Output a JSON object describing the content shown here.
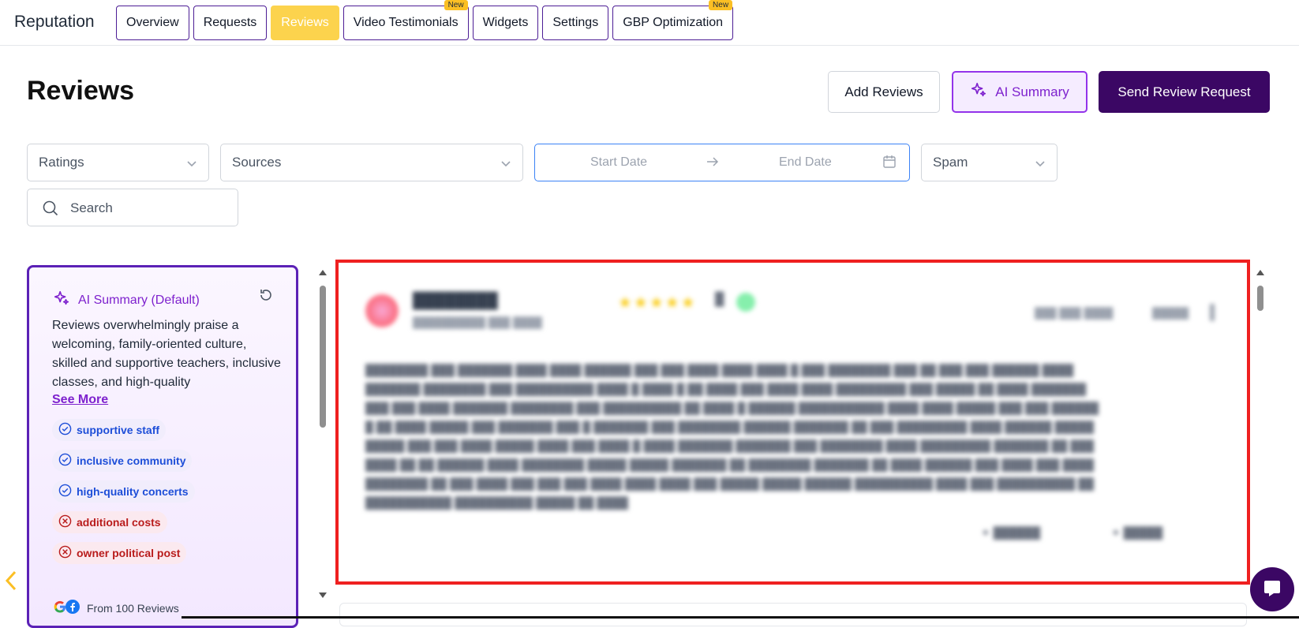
{
  "app": {
    "title": "Reputation"
  },
  "tabs": [
    {
      "label": "Overview",
      "active": false,
      "new": false
    },
    {
      "label": "Requests",
      "active": false,
      "new": false
    },
    {
      "label": "Reviews",
      "active": true,
      "new": false
    },
    {
      "label": "Video Testimonials",
      "active": false,
      "new": true
    },
    {
      "label": "Widgets",
      "active": false,
      "new": false
    },
    {
      "label": "Settings",
      "active": false,
      "new": false
    },
    {
      "label": "GBP Optimization",
      "active": false,
      "new": true
    }
  ],
  "new_badge": "New",
  "page": {
    "title": "Reviews"
  },
  "header_buttons": {
    "add_reviews": "Add Reviews",
    "ai_summary": "AI Summary",
    "send_request": "Send Review Request"
  },
  "filters": {
    "ratings": "Ratings",
    "sources": "Sources",
    "start_date": "Start Date",
    "end_date": "End Date",
    "spam": "Spam",
    "search_placeholder": "Search"
  },
  "ai_panel": {
    "title": "AI Summary (Default)",
    "summary": "Reviews overwhelmingly praise a welcoming, family-oriented culture, skilled and supportive teachers, inclusive classes, and high-quality",
    "see_more": "See More",
    "tags": [
      {
        "label": "supportive staff",
        "sentiment": "positive"
      },
      {
        "label": "inclusive community",
        "sentiment": "positive"
      },
      {
        "label": "high-quality concerts",
        "sentiment": "positive"
      },
      {
        "label": "additional costs",
        "sentiment": "negative"
      },
      {
        "label": "owner political post",
        "sentiment": "negative"
      }
    ],
    "from_reviews": "From 100 Reviews"
  },
  "colors": {
    "brand": "#3b0764",
    "accent_purple": "#7e22ce",
    "active_tab": "#fcd34d",
    "highlight_border": "#ef2020",
    "positive_tag": "#1d4ed8",
    "negative_tag": "#b91c1c"
  },
  "icons": {
    "sparkle": "sparkle-icon",
    "refresh": "refresh-icon",
    "chevron": "chevron-down-icon",
    "calendar": "calendar-icon",
    "search": "search-icon",
    "check": "check-circle-icon",
    "x": "x-circle-icon",
    "chat": "chat-icon"
  }
}
